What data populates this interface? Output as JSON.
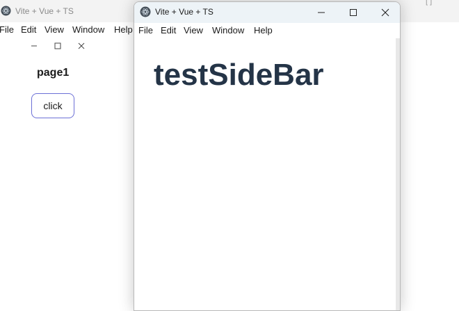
{
  "background_window": {
    "title": "Vite + Vue + TS",
    "far_right_text": "[ ]",
    "menu": [
      "File",
      "Edit",
      "View",
      "Window",
      "Help"
    ],
    "page_heading": "page1",
    "button_label": "click",
    "icons": [
      "app-logo-icon",
      "minimize-icon",
      "maximize-icon",
      "close-icon"
    ]
  },
  "foreground_window": {
    "title": "Vite + Vue + TS",
    "menu": [
      "File",
      "Edit",
      "View",
      "Window",
      "Help"
    ],
    "heading": "testSideBar",
    "icons": [
      "app-logo-icon",
      "minimize-icon",
      "maximize-icon",
      "close-icon"
    ]
  },
  "colors": {
    "heading_text": "#243447",
    "button_border": "#6b6fd6",
    "active_titlebar": "#edf3f7",
    "inactive_titlebar": "#f3f3f3"
  }
}
